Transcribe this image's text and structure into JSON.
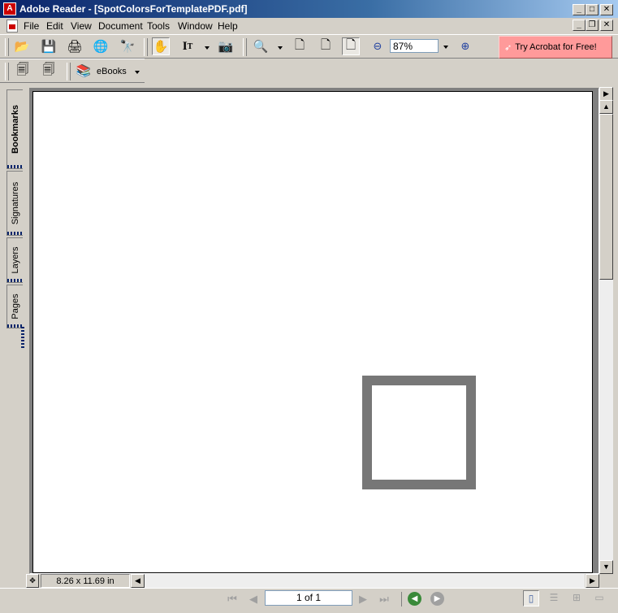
{
  "window": {
    "title": "Adobe Reader - [SpotColorsForTemplatePDF.pdf]"
  },
  "menu": [
    "File",
    "Edit",
    "View",
    "Document",
    "Tools",
    "Window",
    "Help"
  ],
  "toolbar": {
    "zoom_value": "87%",
    "try_acrobat_label": "Try Acrobat for Free!",
    "ebooks_label": "eBooks"
  },
  "nav_tabs": [
    "Bookmarks",
    "Signatures",
    "Layers",
    "Pages"
  ],
  "document": {
    "page_size": "8.26 x 11.69 in"
  },
  "status": {
    "page_indicator": "1 of 1"
  },
  "colors": {
    "title_bar": "#0a246a",
    "try_acrobat_bg": "#ff9a9a",
    "square_stroke": "#777777"
  }
}
